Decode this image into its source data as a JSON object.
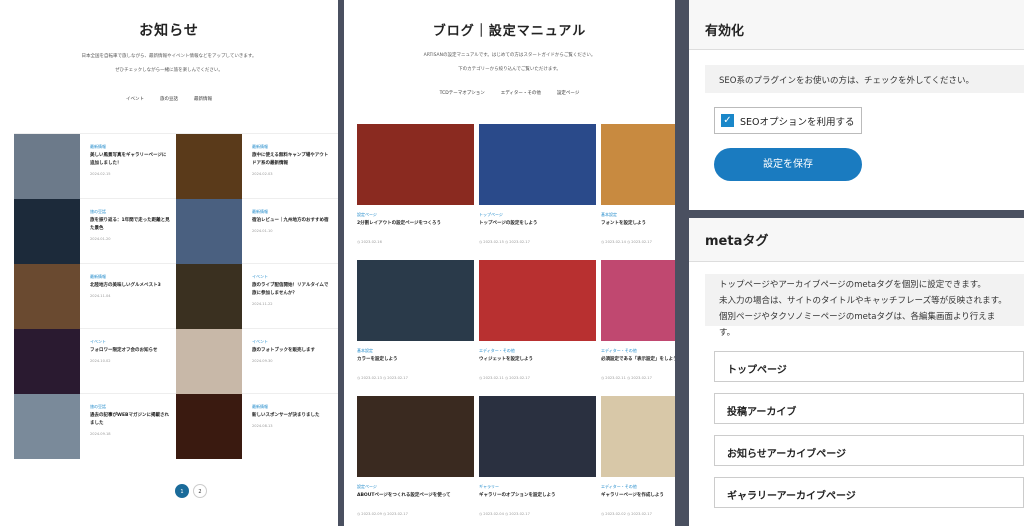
{
  "panel1": {
    "title": "お知らせ",
    "desc1": "日本全国を自転車で旅しながら、最新情報やイベント情報などをアップしていきます。",
    "desc2": "ぜひチェックしながら一緒に旅を楽しんでください。",
    "tabs": [
      "イベント",
      "旅の豆話",
      "最新情報"
    ],
    "items": [
      {
        "cat": "最新情報",
        "title": "美しい風景写真をギャラリーページに追加しました！",
        "date": "2024.02.15",
        "color": "#6c7a8a"
      },
      {
        "cat": "最新情報",
        "title": "旅中に使える無料キャンプ場やアウトドア系の最新情報",
        "date": "2024.02.03",
        "color": "#5a3a1a"
      },
      {
        "cat": "旅の豆話",
        "title": "旅を振り返る：1年間で走った距離と見た景色",
        "date": "2024.01.20",
        "color": "#1c2a3a"
      },
      {
        "cat": "最新情報",
        "title": "宿泊レビュー｜九州地方のおすすめ宿",
        "date": "2024.01.10",
        "color": "#4a6080"
      },
      {
        "cat": "最新情報",
        "title": "北陸地方の美味しいグルメベスト3",
        "date": "2024.11.04",
        "color": "#6a4a30"
      },
      {
        "cat": "イベント",
        "title": "旅のライブ配信開始！リアルタイムで旅に参加しませんか？",
        "date": "2024.11.22",
        "color": "#3a3020"
      },
      {
        "cat": "イベント",
        "title": "フォロワー限定オフ会のお知らせ",
        "date": "2024.10.02",
        "color": "#2a1a30"
      },
      {
        "cat": "イベント",
        "title": "旅のフォトブックを販売します",
        "date": "2024.09.30",
        "color": "#c8b8a8"
      },
      {
        "cat": "旅の豆話",
        "title": "過去の記事がWEBマガジンに掲載されました",
        "date": "2024.09.18",
        "color": "#7a8a9a"
      },
      {
        "cat": "最新情報",
        "title": "新しいスポンサーが決まりました",
        "date": "2024.08.13",
        "color": "#3a1a10"
      }
    ],
    "pages": [
      "1",
      "2"
    ]
  },
  "panel2": {
    "title": "ブログ｜設定マニュアル",
    "desc1": "ARTISANの設定マニュアルです。はじめての方はスタートガイドからご覧ください。",
    "desc2": "下のカテゴリーから絞り込んでご覧いただけます。",
    "tabs": [
      "TCDテーマオプション",
      "エディター・その他",
      "設定ページ"
    ],
    "cards": [
      {
        "cat": "設定ページ",
        "title": "2分割レイアウトの設定ページをつくろう",
        "meta": "◷ 2023.02.16",
        "color": "#8a2a20"
      },
      {
        "cat": "トップページ",
        "title": "トップページの設定をしよう",
        "meta": "◷ 2023.02.15 ◷ 2023.02.17",
        "color": "#2a4a8a"
      },
      {
        "cat": "基本設定",
        "title": "フォントを設定しよう",
        "meta": "◷ 2023.02.14 ◷ 2023.02.17",
        "color": "#c88a40"
      },
      {
        "cat": "基本設定",
        "title": "カラーを設定しよう",
        "meta": "◷ 2023.02.13 ◷ 2023.02.17",
        "color": "#2a3a4a"
      },
      {
        "cat": "エディター・その他",
        "title": "ウィジェットを設定しよう",
        "meta": "◷ 2023.02.11 ◷ 2023.02.17",
        "color": "#b83030"
      },
      {
        "cat": "エディター・その他",
        "title": "必須設定である「表示設定」をしよう",
        "meta": "◷ 2023.02.11 ◷ 2023.02.17",
        "color": "#c04870"
      },
      {
        "cat": "設定ページ",
        "title": "ABOUTページをつくれる設定ページを使って",
        "meta": "◷ 2023.02.09 ◷ 2023.02.17",
        "color": "#3a2a20"
      },
      {
        "cat": "ギャラリー",
        "title": "ギャラリーのオプションを設定しよう",
        "meta": "◷ 2023.02.04 ◷ 2023.02.17",
        "color": "#2a3040"
      },
      {
        "cat": "エディター・その他",
        "title": "ギャラリーページを作成しよう",
        "meta": "◷ 2023.02.02 ◷ 2023.02.17",
        "color": "#d8c8a8"
      }
    ]
  },
  "panel3": {
    "enable": {
      "title": "有効化",
      "note": "SEO系のプラグインをお使いの方は、チェックを外してください。",
      "check_label": "SEOオプションを利用する",
      "check_mark": "✓",
      "save_label": "設定を保存"
    },
    "meta": {
      "title": "metaタグ",
      "lines": [
        "トップページやアーカイブページのmetaタグを個別に設定できます。",
        "未入力の場合は、サイトのタイトルやキャッチフレーズ等が反映されます。",
        "個別ページやタクソノミーページのmetaタグは、各編集画面より行えます。"
      ],
      "items": [
        "トップページ",
        "投稿アーカイブ",
        "お知らせアーカイブページ",
        "ギャラリーアーカイブページ"
      ]
    }
  }
}
